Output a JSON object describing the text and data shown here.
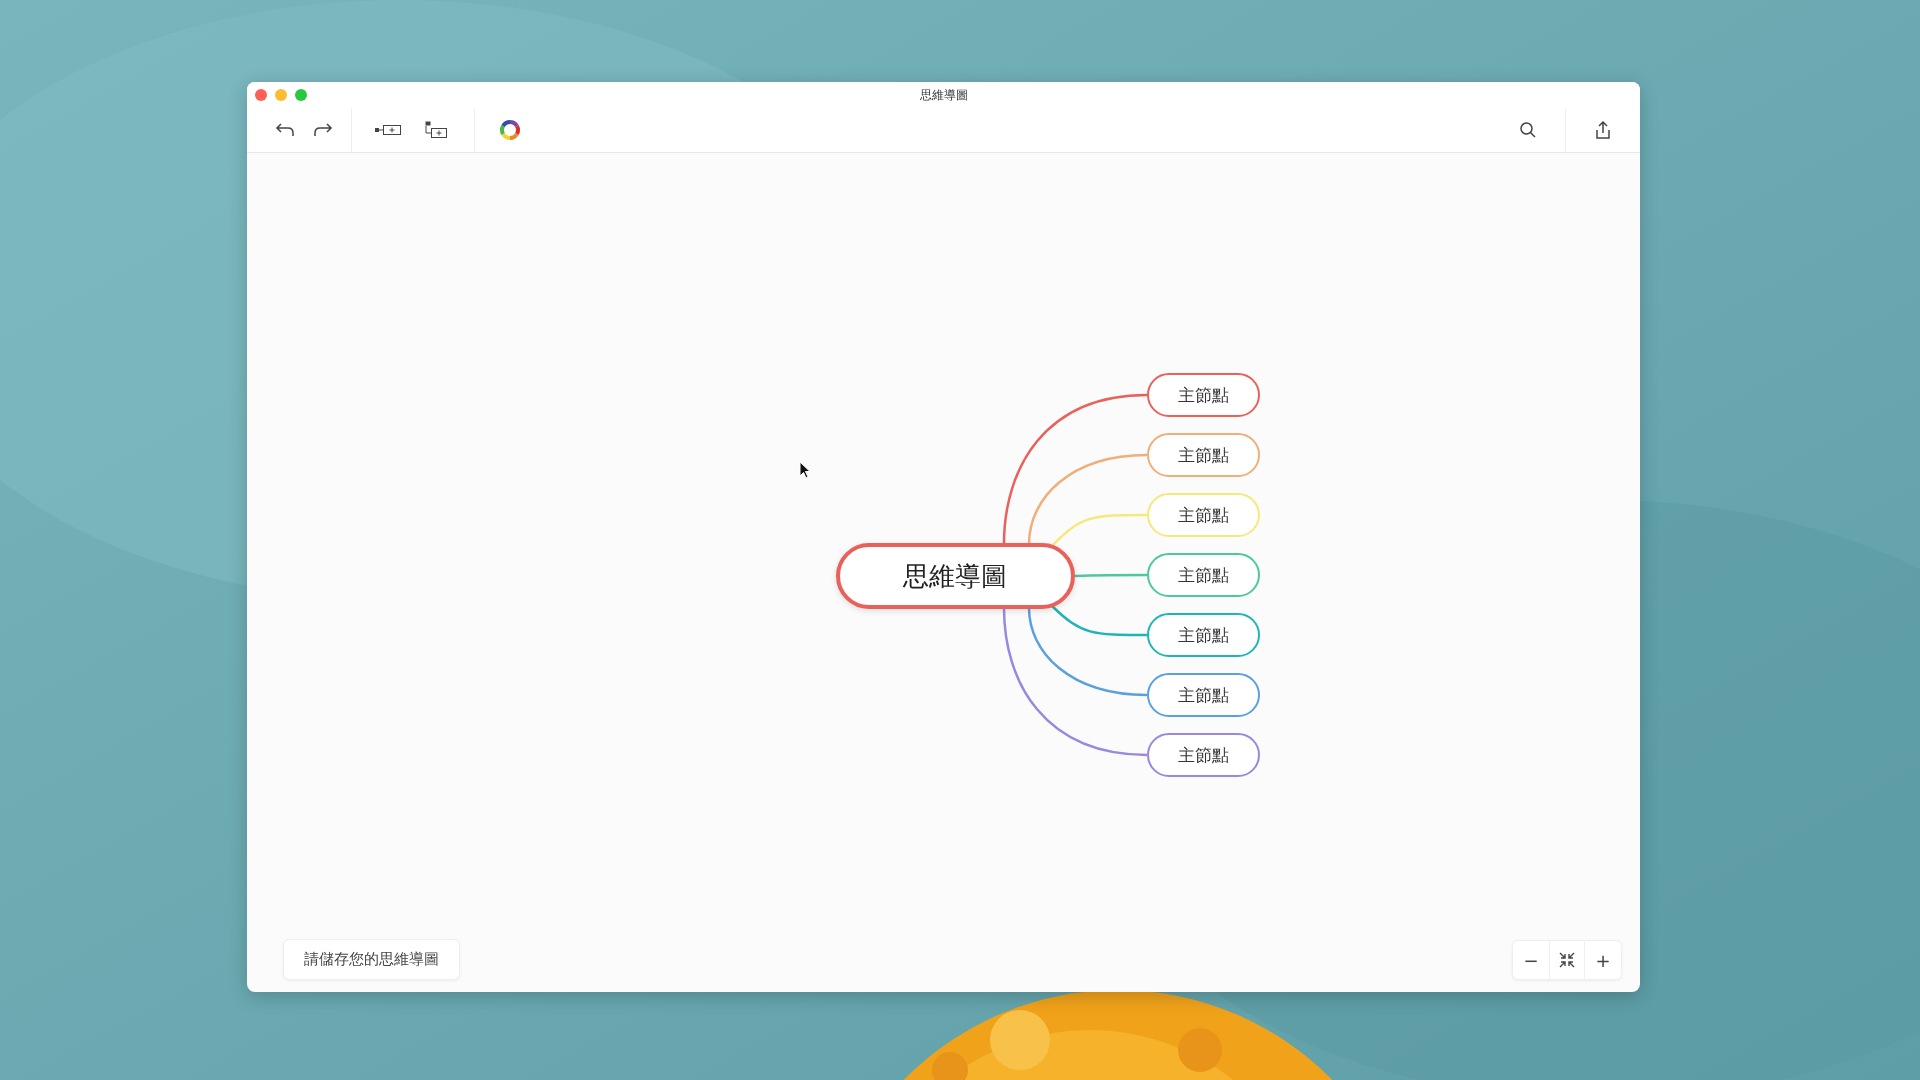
{
  "window": {
    "title": "思維導圖"
  },
  "mind_map": {
    "root": {
      "label": "思維導圖"
    },
    "children": [
      {
        "label": "主節點",
        "color": "#e8615a"
      },
      {
        "label": "主節點",
        "color": "#f0ae7a"
      },
      {
        "label": "主節點",
        "color": "#f5e97a"
      },
      {
        "label": "主節點",
        "color": "#4cc8a0"
      },
      {
        "label": "主節點",
        "color": "#1fb5b8"
      },
      {
        "label": "主節點",
        "color": "#5aa0de"
      },
      {
        "label": "主節點",
        "color": "#9a88e0"
      }
    ]
  },
  "save_hint": "請儲存您的思維導圖",
  "zoom_controls": {
    "zoom_out": "−",
    "zoom_in": "+"
  }
}
